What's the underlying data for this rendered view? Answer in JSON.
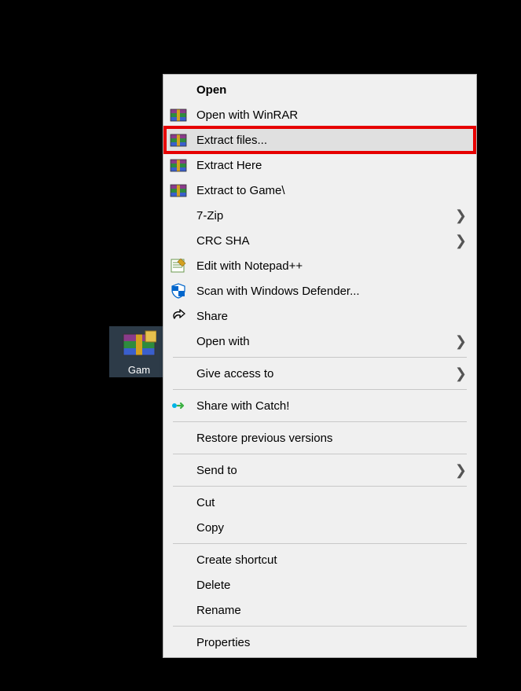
{
  "desktop": {
    "icon_label": "Gam"
  },
  "menu": {
    "open": "Open",
    "open_winrar": "Open with WinRAR",
    "extract_files": "Extract files...",
    "extract_here": "Extract Here",
    "extract_to": "Extract to Game\\",
    "seven_zip": "7-Zip",
    "crc_sha": "CRC SHA",
    "edit_notepadpp": "Edit with Notepad++",
    "scan_defender": "Scan with Windows Defender...",
    "share": "Share",
    "open_with": "Open with",
    "give_access": "Give access to",
    "share_catch": "Share with Catch!",
    "restore_versions": "Restore previous versions",
    "send_to": "Send to",
    "cut": "Cut",
    "copy": "Copy",
    "create_shortcut": "Create shortcut",
    "delete": "Delete",
    "rename": "Rename",
    "properties": "Properties"
  }
}
